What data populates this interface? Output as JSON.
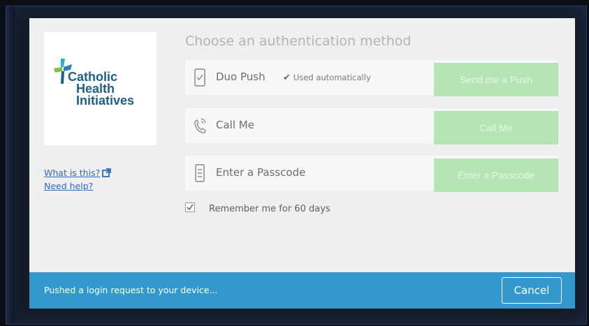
{
  "logo": {
    "name_lines": [
      "Catholic",
      "Health",
      "Initiatives"
    ]
  },
  "sidebar": {
    "what_is_this": "What is this?",
    "need_help": "Need help?"
  },
  "main": {
    "title": "Choose an authentication method",
    "methods": [
      {
        "label": "Duo Push",
        "note": "Used automatically",
        "button": "Send me a Push",
        "icon": "phone-icon"
      },
      {
        "label": "Call Me",
        "button": "Call Me",
        "icon": "phone-ring-icon"
      },
      {
        "label": "Enter a Passcode",
        "button": "Enter a Passcode",
        "icon": "passcode-device-icon"
      }
    ],
    "remember": "Remember me for 60 days"
  },
  "status": {
    "message": "Pushed a login request to your device...",
    "cancel": "Cancel"
  },
  "colors": {
    "accent": "#3399cc",
    "button_disabled": "#b5e5b4",
    "link": "#2d6cc0",
    "logo_text": "#1f5f8b"
  }
}
